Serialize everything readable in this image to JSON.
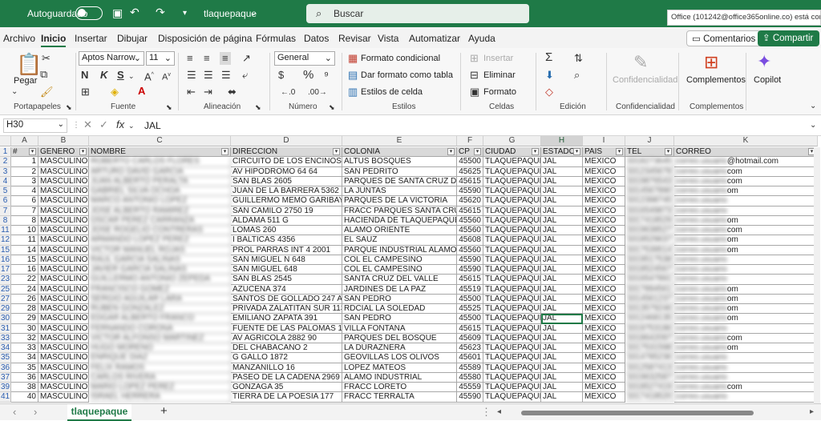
{
  "titlebar": {
    "autosave_label": "Autoguardado",
    "filename": "tlaquepaque",
    "search_label": "Buscar",
    "account_text": "Office (101242@office365online.co) está conectado"
  },
  "menu": {
    "items": [
      "Archivo",
      "Inicio",
      "Insertar",
      "Dibujar",
      "Disposición de página",
      "Fórmulas",
      "Datos",
      "Revisar",
      "Vista",
      "Automatizar",
      "Ayuda"
    ],
    "active": "Inicio",
    "comments_label": "Comentarios",
    "share_label": "Compartir"
  },
  "ribbon": {
    "paste": "Pegar",
    "font_name": "Aptos Narrow",
    "font_size": "11",
    "bold": "N",
    "italic": "K",
    "underline": "S",
    "number_format": "General",
    "cond_format": "Formato condicional",
    "table_format": "Dar formato como tabla",
    "cell_styles": "Estilos de celda",
    "insert": "Insertar",
    "delete": "Eliminar",
    "format": "Formato",
    "confidentiality": "Confidencialidad",
    "addins": "Complementos",
    "copilot": "Copilot",
    "groups": {
      "clipboard": "Portapapeles",
      "font": "Fuente",
      "alignment": "Alineación",
      "number": "Número",
      "styles": "Estilos",
      "cells": "Celdas",
      "editing": "Edición",
      "confidentiality": "Confidencialidad",
      "addins": "Complementos"
    }
  },
  "formula_bar": {
    "cell_ref": "H30",
    "content": "JAL",
    "fx": "fx"
  },
  "sheet": {
    "columns": [
      "A",
      "B",
      "C",
      "D",
      "E",
      "F",
      "G",
      "H",
      "I",
      "J",
      "K"
    ],
    "selected_column": "H",
    "header_row": [
      "#",
      "GENERO",
      "NOMBRE",
      "DIRECCION",
      "COLONIA",
      "CP",
      "CIUDAD",
      "ESTADO",
      "PAIS",
      "TEL",
      "CORREO"
    ],
    "rows": [
      {
        "r": "2",
        "n": "1",
        "g": "MASCULINO",
        "name": "ROBERTO CARLOS FLORES",
        "dir": "CIRCUITO DE LOS ENCINOS 109",
        "col": "ALTUS BOSQUES",
        "cp": "45500",
        "city": "TLAQUEPAQUE",
        "st": "JAL",
        "pais": "MEXICO",
        "tel": "3318273645",
        "mail": "@hotmail.com"
      },
      {
        "r": "3",
        "n": "2",
        "g": "MASCULINO",
        "name": "ARTURO DAVID GARCIA",
        "dir": "AV HIPODROMO 64 64",
        "col": "SAN PEDRITO",
        "cp": "45625",
        "city": "TLAQUEPAQUE",
        "st": "JAL",
        "pais": "MEXICO",
        "tel": "3312345678",
        "mail": "com"
      },
      {
        "r": "4",
        "n": "3",
        "g": "MASCULINO",
        "name": "JUAN ALBERTO PERALTA",
        "dir": "SAN BLAS 2605",
        "col": "PARQUES DE SANTA CRUZ DEL VAL",
        "cp": "45615",
        "city": "TLAQUEPAQUE",
        "st": "JAL",
        "pais": "MEXICO",
        "tel": "3319876543",
        "mail": "com"
      },
      {
        "r": "5",
        "n": "4",
        "g": "MASCULINO",
        "name": "GABRIEL SILVA OCHOA",
        "dir": "JUAN DE LA BARRERA 5362",
        "col": "LA JUNTAS",
        "cp": "45590",
        "city": "TLAQUEPAQUE",
        "st": "JAL",
        "pais": "MEXICO",
        "tel": "3314567890",
        "mail": "om"
      },
      {
        "r": "6",
        "n": "6",
        "g": "MASCULINO",
        "name": "MARCO ANTONIO LOPEZ",
        "dir": "GUILLERMO MEMO GARIBAY 570",
        "col": "PARQUES DE LA VICTORIA",
        "cp": "45620",
        "city": "TLAQUEPAQUE",
        "st": "JAL",
        "pais": "MEXICO",
        "tel": "3312398745",
        "mail": ""
      },
      {
        "r": "7",
        "n": "7",
        "g": "MASCULINO",
        "name": "JOSE ALBERTO RAMIREZ",
        "dir": "SAN CAMILO 2750 19",
        "col": "FRACC PARQUES SANTA CRUZ DEL",
        "cp": "45615",
        "city": "TLAQUEPAQUE",
        "st": "JAL",
        "pais": "MEXICO",
        "tel": "3316549873",
        "mail": ""
      },
      {
        "r": "8",
        "n": "8",
        "g": "MASCULINO",
        "name": "OSCAR PEREZ CARRANZA",
        "dir": "ALDAMA 511 G",
        "col": "HACIENDA DE TLAQUEPAQUE",
        "cp": "45560",
        "city": "TLAQUEPAQUE",
        "st": "JAL",
        "pais": "MEXICO",
        "tel": "3317418529",
        "mail": "om"
      },
      {
        "r": "11",
        "n": "10",
        "g": "MASCULINO",
        "name": "JOSE ROGELIO CONTRERAS",
        "dir": "LOMAS 260",
        "col": "ALAMO ORIENTE",
        "cp": "45560",
        "city": "TLAQUEPAQUE",
        "st": "JAL",
        "pais": "MEXICO",
        "tel": "3319638527",
        "mail": "com"
      },
      {
        "r": "12",
        "n": "11",
        "g": "MASCULINO",
        "name": "ARMANDO LOPEZ PEREZ",
        "dir": "I BALTICAS 4356",
        "col": "EL SAUZ",
        "cp": "45608",
        "city": "TLAQUEPAQUE",
        "st": "JAL",
        "pais": "MEXICO",
        "tel": "3318529637",
        "mail": "om"
      },
      {
        "r": "15",
        "n": "14",
        "g": "MASCULINO",
        "name": "VICTOR MANUEL ROJAS",
        "dir": "PROL PARRAS INT 4 2001",
        "col": "PARQUE INDUSTRIAL ALAMO",
        "cp": "45560",
        "city": "TLAQUEPAQUE",
        "st": "JAL",
        "pais": "MEXICO",
        "tel": "3317539514",
        "mail": "om"
      },
      {
        "r": "16",
        "n": "15",
        "g": "MASCULINO",
        "name": "RAUL GARCIA SALINAS",
        "dir": "SAN MIGUEL N 648",
        "col": "COL EL CAMPESINO",
        "cp": "45590",
        "city": "TLAQUEPAQUE",
        "st": "JAL",
        "pais": "MEXICO",
        "tel": "3319517538",
        "mail": ""
      },
      {
        "r": "17",
        "n": "16",
        "g": "MASCULINO",
        "name": "JAVIER GARCIA SALINAS",
        "dir": "SAN MIGUEL 648",
        "col": "COL EL CAMPESINO",
        "cp": "45590",
        "city": "TLAQUEPAQUE",
        "st": "JAL",
        "pais": "MEXICO",
        "tel": "3318524567",
        "mail": ""
      },
      {
        "r": "23",
        "n": "22",
        "g": "MASCULINO",
        "name": "GUILLERMO ANTONIO ZEPEDA",
        "dir": "SAN BLAS 2545",
        "col": "SANTA CRUZ DEL VALLE",
        "cp": "45615",
        "city": "TLAQUEPAQUE",
        "st": "JAL",
        "pais": "MEXICO",
        "tel": "3316547891",
        "mail": ""
      },
      {
        "r": "25",
        "n": "24",
        "g": "MASCULINO",
        "name": "FRANCISCO GOMEZ",
        "dir": "AZUCENA 374",
        "col": "JARDINES DE LA PAZ",
        "cp": "45519",
        "city": "TLAQUEPAQUE",
        "st": "JAL",
        "pais": "MEXICO",
        "tel": "3317894561",
        "mail": "om"
      },
      {
        "r": "27",
        "n": "26",
        "g": "MASCULINO",
        "name": "SERGIO AGUILAR LARA",
        "dir": "SANTOS DE GOLLADO 247 A",
        "col": "SAN PEDRO",
        "cp": "45500",
        "city": "TLAQUEPAQUE",
        "st": "JAL",
        "pais": "MEXICO",
        "tel": "3314561237",
        "mail": "om"
      },
      {
        "r": "29",
        "n": "28",
        "g": "MASCULINO",
        "name": "RUBEN GONZALEZ",
        "dir": "PRIVADA ZALATITAN SUR 1134",
        "col": "RDCIAL LA SOLEDAD",
        "cp": "45525",
        "city": "TLAQUEPAQUE",
        "st": "JAL",
        "pais": "MEXICO",
        "tel": "3313579246",
        "mail": "om"
      },
      {
        "r": "30",
        "n": "29",
        "g": "MASCULINO",
        "name": "EDGAR ALBERTO FRANCO",
        "dir": "EMILIANO ZAPATA 391",
        "col": "SAN PEDRO",
        "cp": "45500",
        "city": "TLAQUEPAQUE",
        "st": "JAL",
        "pais": "MEXICO",
        "tel": "3312468135",
        "mail": "om"
      },
      {
        "r": "31",
        "n": "30",
        "g": "MASCULINO",
        "name": "FERNANDO CORONA",
        "dir": "FUENTE DE LAS PALOMAS 1518",
        "col": "VILLA FONTANA",
        "cp": "45615",
        "city": "TLAQUEPAQUE",
        "st": "JAL",
        "pais": "MEXICO",
        "tel": "3319753186",
        "mail": ""
      },
      {
        "r": "33",
        "n": "32",
        "g": "MASCULINO",
        "name": "VICTOR ALFONSO MARTINEZ",
        "dir": "AV AGRICOLA 2882 90",
        "col": "PARQUES DEL BOSQUE",
        "cp": "45609",
        "city": "TLAQUEPAQUE",
        "st": "JAL",
        "pais": "MEXICO",
        "tel": "3318642097",
        "mail": "com"
      },
      {
        "r": "34",
        "n": "33",
        "g": "MASCULINO",
        "name": "HUGO MORENO",
        "dir": "DEL CHABACANO 2",
        "col": "LA DURAZNERA",
        "cp": "45623",
        "city": "TLAQUEPAQUE",
        "st": "JAL",
        "pais": "MEXICO",
        "tel": "3317531598",
        "mail": "om"
      },
      {
        "r": "35",
        "n": "34",
        "g": "MASCULINO",
        "name": "ENRIQUE DIAZ",
        "dir": "G GALLO 1872",
        "col": "GEOVILLAS LOS OLIVOS",
        "cp": "45601",
        "city": "TLAQUEPAQUE",
        "st": "JAL",
        "pais": "MEXICO",
        "tel": "3314785236",
        "mail": ""
      },
      {
        "r": "36",
        "n": "35",
        "g": "MASCULINO",
        "name": "FELIX RAMOS",
        "dir": "MANZANILLO 16",
        "col": "LOPEZ MATEOS",
        "cp": "45589",
        "city": "TLAQUEPAQUE",
        "st": "JAL",
        "pais": "MEXICO",
        "tel": "3312587413",
        "mail": ""
      },
      {
        "r": "37",
        "n": "36",
        "g": "MASCULINO",
        "name": "CARLOS RIVERA",
        "dir": "PASEO DE LA CADENA 2969",
        "col": "ALAMO INDUSTRIAL",
        "cp": "45580",
        "city": "TLAQUEPAQUE",
        "st": "JAL",
        "pais": "MEXICO",
        "tel": "3319632587",
        "mail": ""
      },
      {
        "r": "39",
        "n": "38",
        "g": "MASCULINO",
        "name": "MARIO LOPEZ PEREZ",
        "dir": "GONZAGA 35",
        "col": "FRACC LORETO",
        "cp": "45559",
        "city": "TLAQUEPAQUE",
        "st": "JAL",
        "pais": "MEXICO",
        "tel": "3318527419",
        "mail": "com"
      },
      {
        "r": "41",
        "n": "40",
        "g": "MASCULINO",
        "name": "ISRAEL HERRERA",
        "dir": "TIERRA DE LA POESIA 177",
        "col": "FRACC TERRALTA",
        "cp": "45590",
        "city": "TLAQUEPAQUE",
        "st": "JAL",
        "pais": "MEXICO",
        "tel": "3317418520",
        "mail": ""
      }
    ]
  },
  "bottom": {
    "sheet_tab": "tlaquepaque",
    "add_sheet": "+"
  }
}
